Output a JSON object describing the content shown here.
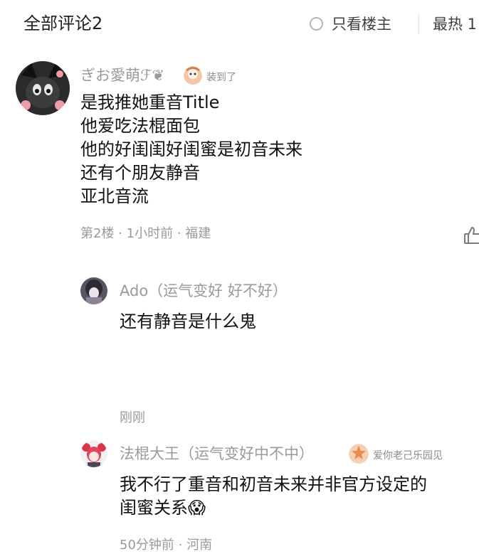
{
  "header": {
    "title": "全部评论2",
    "only_op_label": "只看楼主",
    "sort_label": "最热 1"
  },
  "comment": {
    "username": "ぎお愛萌ℱ❦",
    "badge_text": "装到了",
    "lines": "是我推她重音Title\n他爱吃法棍面包\n他的好闺闺好闺蜜是初音未来\n还有个朋友静音\n亚北音流",
    "meta": "第2楼 · 1小时前 · 福建",
    "replies": [
      {
        "username": "Ado（运气变好 好不好）",
        "text": "还有静音是什么鬼",
        "meta": "刚刚"
      },
      {
        "username": "法棍大王（运气变好中不中）",
        "badge_text": "爱你老己乐园见",
        "text": "我不行了重音和初音未来并非官方设定的\n闺蜜关系😱",
        "meta": "50分钟前 · 河南"
      }
    ]
  },
  "colors": {
    "text_primary": "#111111",
    "text_secondary": "#9a9a9a",
    "background": "#ffffff"
  }
}
